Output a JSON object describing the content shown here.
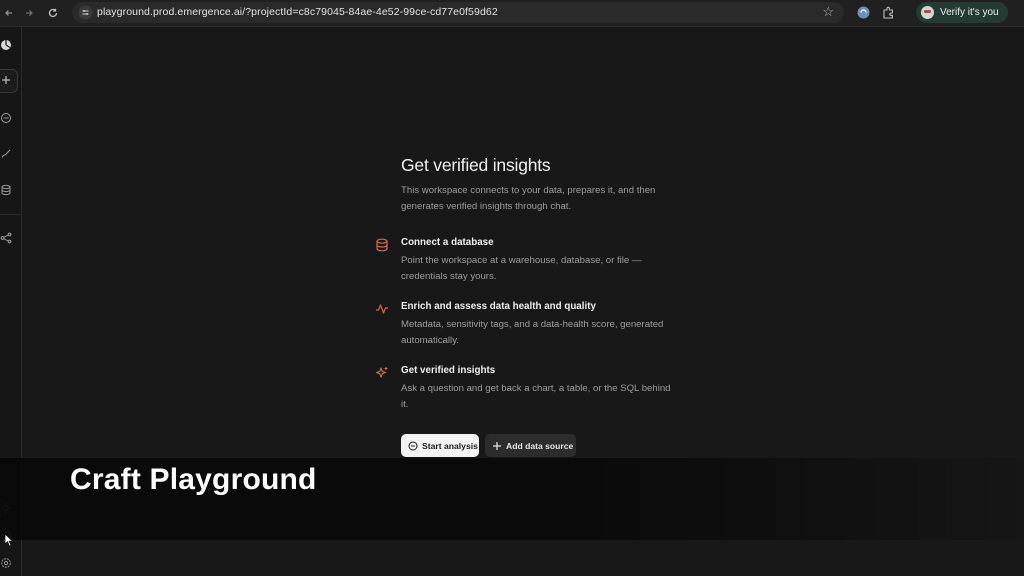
{
  "browser": {
    "url": "playground.prod.emergence.ai/?projectId=c8c79045-84ae-4e52-99ce-cd77e0f59d62",
    "profile_label": "Verify it's you"
  },
  "rail": {
    "icons": [
      "pie-chart-icon",
      "plus-icon",
      "chat-icon",
      "brush-icon",
      "database-icon",
      "share-graph-icon",
      "sun-icon",
      "help-icon",
      "settings-icon"
    ]
  },
  "main": {
    "heading": "Get verified insights",
    "intro": "This workspace connects to your data, prepares it, and then generates verified insights through chat.",
    "steps": [
      {
        "icon": "database-icon",
        "title": "Connect a database",
        "description": "Point the workspace at a warehouse, database, or file — credentials stay yours."
      },
      {
        "icon": "activity-icon",
        "title": "Enrich and assess data health and quality",
        "description": "Metadata, sensitivity tags, and a data-health score, generated automatically."
      },
      {
        "icon": "sparkles-icon",
        "title": "Get verified insights",
        "description": "Ask a question and get back a chart, a table, or the SQL behind it."
      }
    ],
    "primary_button": "Start analysis",
    "secondary_button": "Add data source"
  },
  "caption": "Craft Playground",
  "colors": {
    "accent": "#d9674a",
    "background": "#181818",
    "profile_pill": "#233b33"
  }
}
